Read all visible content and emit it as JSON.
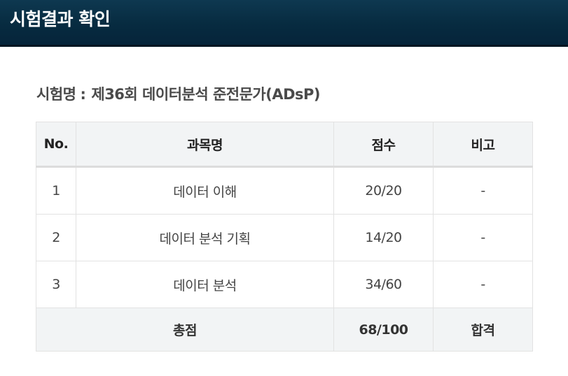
{
  "header": {
    "title": "시험결과 확인"
  },
  "exam": {
    "label": "시험명",
    "separator": ":",
    "name": "제36회 데이터분석 준전문가(ADsP)"
  },
  "table": {
    "columns": {
      "no": "No.",
      "subject": "과목명",
      "score": "점수",
      "note": "비고"
    },
    "rows": [
      {
        "no": "1",
        "subject": "데이터 이해",
        "score": "20/20",
        "note": "-"
      },
      {
        "no": "2",
        "subject": "데이터 분석 기획",
        "score": "14/20",
        "note": "-"
      },
      {
        "no": "3",
        "subject": "데이터 분석",
        "score": "34/60",
        "note": "-"
      }
    ],
    "total": {
      "label": "총점",
      "score": "68/100",
      "result": "합격"
    }
  },
  "colors": {
    "header_bg": "#072b40",
    "header_text": "#ffffff",
    "table_head_bg": "#f2f4f5",
    "border": "#e2e2e2"
  }
}
